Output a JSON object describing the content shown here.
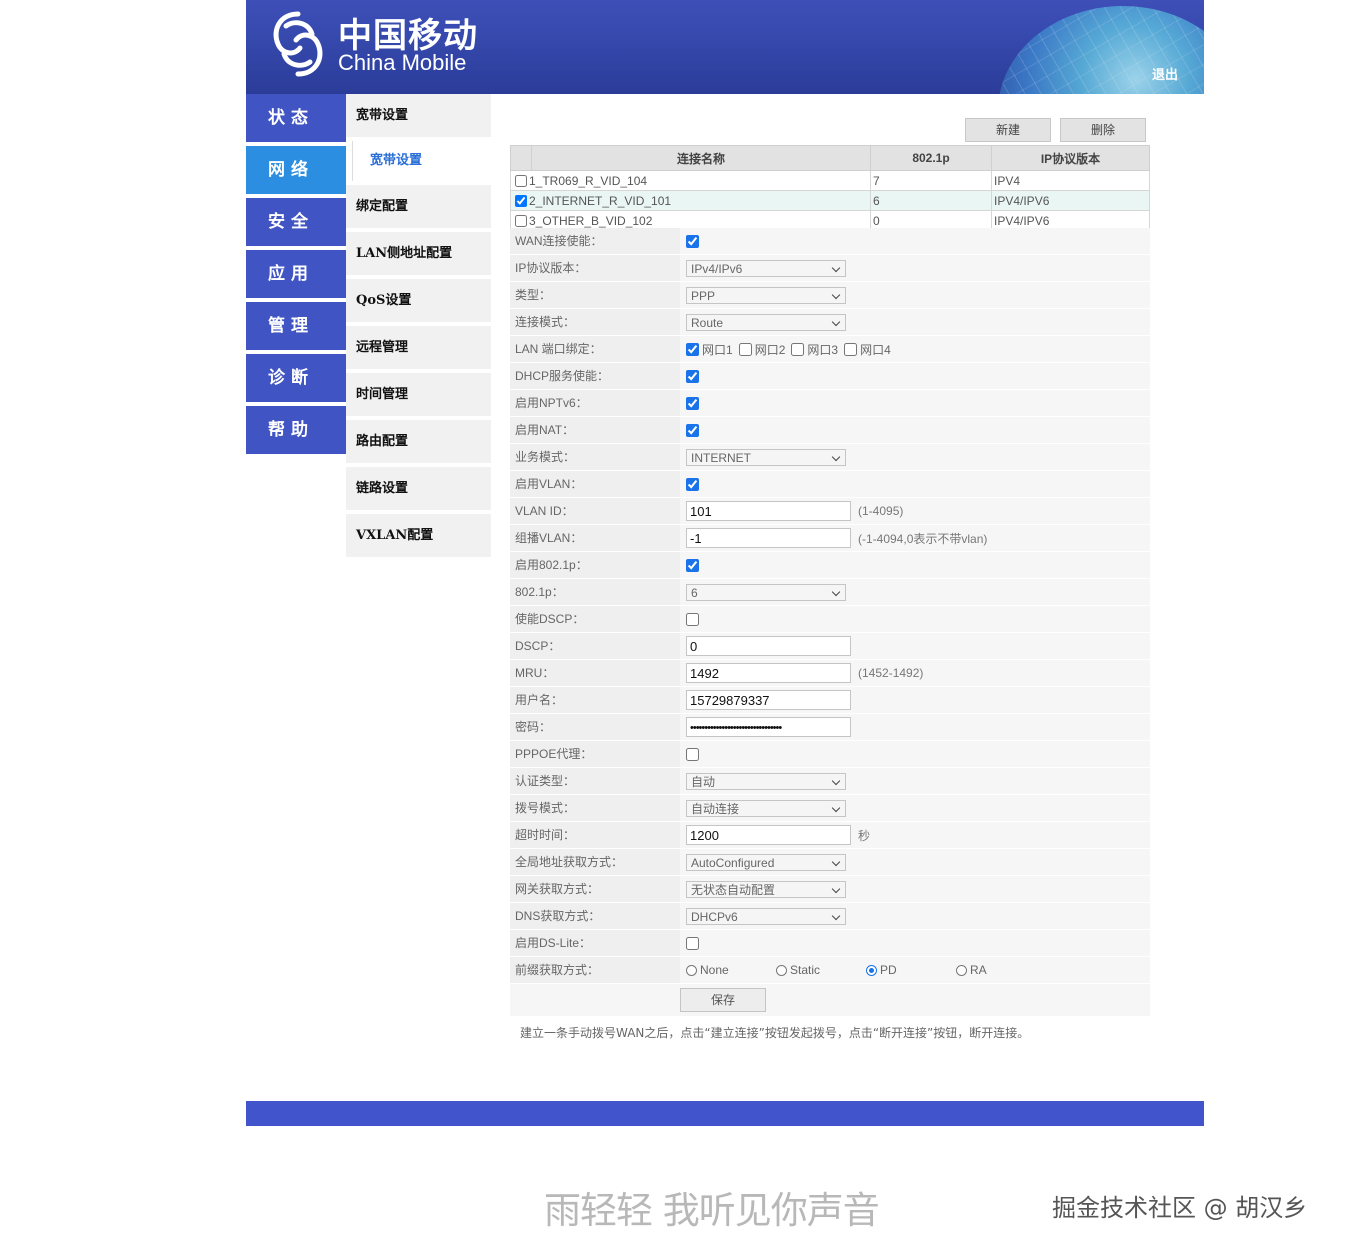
{
  "header": {
    "logo_cn": "中国移动",
    "logo_en": "China Mobile",
    "logout": "退出"
  },
  "main_nav": [
    {
      "label": "状态",
      "active": false
    },
    {
      "label": "网络",
      "active": true
    },
    {
      "label": "安全",
      "active": false
    },
    {
      "label": "应用",
      "active": false
    },
    {
      "label": "管理",
      "active": false
    },
    {
      "label": "诊断",
      "active": false
    },
    {
      "label": "帮助",
      "active": false
    }
  ],
  "sub_nav": {
    "broadband": "宽带设置",
    "broadband_child": "宽带设置",
    "binding": "绑定配置",
    "lan": "LAN侧地址配置",
    "qos": "QoS设置",
    "remote": "远程管理",
    "time": "时间管理",
    "route": "路由配置",
    "link": "链路设置",
    "vxlan": "VXLAN配置"
  },
  "actions": {
    "new": "新建",
    "delete": "删除",
    "save": "保存"
  },
  "wan_table": {
    "headers": [
      "连接名称",
      "802.1p",
      "IP协议版本"
    ],
    "rows": [
      {
        "name": "1_TR069_R_VID_104",
        "p": "7",
        "ip": "IPV4",
        "checked": false
      },
      {
        "name": "2_INTERNET_R_VID_101",
        "p": "6",
        "ip": "IPV4/IPV6",
        "checked": true
      },
      {
        "name": "3_OTHER_B_VID_102",
        "p": "0",
        "ip": "IPV4/IPV6",
        "checked": false
      }
    ]
  },
  "form": {
    "wan_enable": {
      "label": "WAN连接使能：",
      "checked": true
    },
    "ip_version": {
      "label": "IP协议版本：",
      "value": "IPv4/IPv6"
    },
    "type": {
      "label": "类型：",
      "value": "PPP"
    },
    "mode": {
      "label": "连接模式：",
      "value": "Route"
    },
    "lan_bind": {
      "label": "LAN 端口绑定：",
      "ports": [
        {
          "label": "网口1",
          "checked": true
        },
        {
          "label": "网口2",
          "checked": false
        },
        {
          "label": "网口3",
          "checked": false
        },
        {
          "label": "网口4",
          "checked": false
        }
      ]
    },
    "dhcp": {
      "label": "DHCP服务使能：",
      "checked": true
    },
    "nptv6": {
      "label": "启用NPTv6：",
      "checked": true
    },
    "nat": {
      "label": "启用NAT：",
      "checked": true
    },
    "service": {
      "label": "业务模式：",
      "value": "INTERNET"
    },
    "vlan_enable": {
      "label": "启用VLAN：",
      "checked": true
    },
    "vlan_id": {
      "label": "VLAN ID：",
      "value": "101",
      "hint": "(1-4095)"
    },
    "mcast_vlan": {
      "label": "组播VLAN：",
      "value": "-1",
      "hint": "(-1-4094,0表示不带vlan)"
    },
    "p_enable": {
      "label": "启用802.1p：",
      "checked": true
    },
    "p_value": {
      "label": "802.1p：",
      "value": "6"
    },
    "dscp_enable": {
      "label": "使能DSCP：",
      "checked": false
    },
    "dscp": {
      "label": "DSCP：",
      "value": "0"
    },
    "mru": {
      "label": "MRU：",
      "value": "1492",
      "hint": "(1452-1492)"
    },
    "username": {
      "label": "用户名：",
      "value": "15729879337"
    },
    "password": {
      "label": "密码：",
      "value": "••••••••••••••••••••••••••••••••"
    },
    "pppoe_proxy": {
      "label": "PPPOE代理：",
      "checked": false
    },
    "auth": {
      "label": "认证类型：",
      "value": "自动"
    },
    "dial": {
      "label": "拨号模式：",
      "value": "自动连接"
    },
    "timeout": {
      "label": "超时时间：",
      "value": "1200",
      "hint": "秒"
    },
    "global_addr": {
      "label": "全局地址获取方式：",
      "value": "AutoConfigured"
    },
    "gateway": {
      "label": "网关获取方式：",
      "value": "无状态自动配置"
    },
    "dns": {
      "label": "DNS获取方式：",
      "value": "DHCPv6"
    },
    "dslite": {
      "label": "启用DS-Lite：",
      "checked": false
    },
    "prefix": {
      "label": "前缀获取方式：",
      "options": [
        {
          "label": "None",
          "selected": false
        },
        {
          "label": "Static",
          "selected": false
        },
        {
          "label": "PD",
          "selected": true
        },
        {
          "label": "RA",
          "selected": false
        }
      ]
    }
  },
  "note": "建立一条手动拨号WAN之后，点击“建立连接”按钮发起拨号，点击“断开连接”按钮，断开连接。",
  "watermark_left": "雨轻轻 我听见你声音",
  "watermark_right": "掘金技术社区 @ 胡汉乡"
}
